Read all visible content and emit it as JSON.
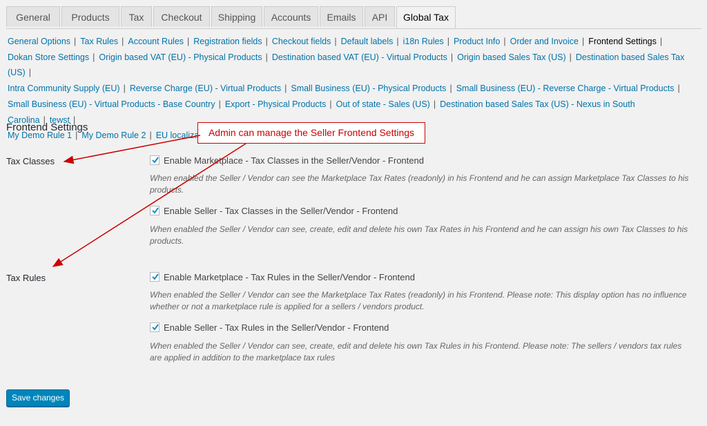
{
  "tabs": [
    "General",
    "Products",
    "Tax",
    "Checkout",
    "Shipping",
    "Accounts",
    "Emails",
    "API",
    "Global Tax"
  ],
  "active_tab": "Global Tax",
  "sub_links": [
    [
      "General Options",
      "Tax Rules",
      "Account Rules",
      "Registration fields",
      "Checkout fields",
      "Default labels",
      "i18n Rules",
      "Product Info",
      "Order and Invoice",
      "Frontend Settings"
    ],
    [
      "Dokan Store Settings",
      "Origin based VAT (EU) - Physical Products",
      "Destination based VAT (EU) - Virtual Products",
      "Origin based Sales Tax (US)",
      "Destination based Sales Tax (US)"
    ],
    [
      "Intra Community Supply (EU)",
      "Reverse Charge (EU) - Virtual Products",
      "Small Business (EU) - Physical Products",
      "Small Business (EU) - Reverse Charge - Virtual Products"
    ],
    [
      "Small Business (EU) - Virtual Products - Base Country",
      "Export - Physical Products",
      "Out of state - Sales (US)",
      "Destination based Sales Tax (US) - Nexus in South Carolina",
      "tewst"
    ],
    [
      "My Demo Rule 1",
      "My Demo Rule 2",
      "EU localization",
      "US localization",
      "t",
      "zz"
    ]
  ],
  "current_sub_link": "Frontend Settings",
  "section_title": "Frontend Settings",
  "callout_text": "Admin can manage the Seller Frontend Settings",
  "tax_classes": {
    "label": "Tax Classes",
    "opt1": "Enable Marketplace - Tax Classes in the Seller/Vendor - Frontend",
    "desc1": "When enabled the Seller / Vendor can see the Marketplace Tax Rates (readonly) in his Frontend and he can assign Marketplace Tax Classes to his products.",
    "opt2": "Enable Seller - Tax Classes in the Seller/Vendor - Frontend",
    "desc2": "When enabled the Seller / Vendor can see, create, edit and delete his own Tax Rates in his Frontend and he can assign his own Tax Classes to his products."
  },
  "tax_rules": {
    "label": "Tax Rules",
    "opt1": "Enable Marketplace - Tax Rules in the Seller/Vendor - Frontend",
    "desc1": "When enabled the Seller / Vendor can see the Marketplace Tax Rates (readonly) in his Frontend. Please note: This display option has no influence whether or not a marketplace rule is applied for a sellers / vendors product.",
    "opt2": "Enable Seller - Tax Rules in the Seller/Vendor - Frontend",
    "desc2": "When enabled the Seller / Vendor can see, create, edit and delete his own Tax Rules in his Frontend. Please note: The sellers / vendors tax rules are applied in addition to the marketplace tax rules"
  },
  "save_label": "Save changes",
  "checkbox_icon": "checkmark-icon",
  "colors": {
    "link": "#0073aa",
    "accent": "#0085ba",
    "callout": "#cc0000"
  }
}
